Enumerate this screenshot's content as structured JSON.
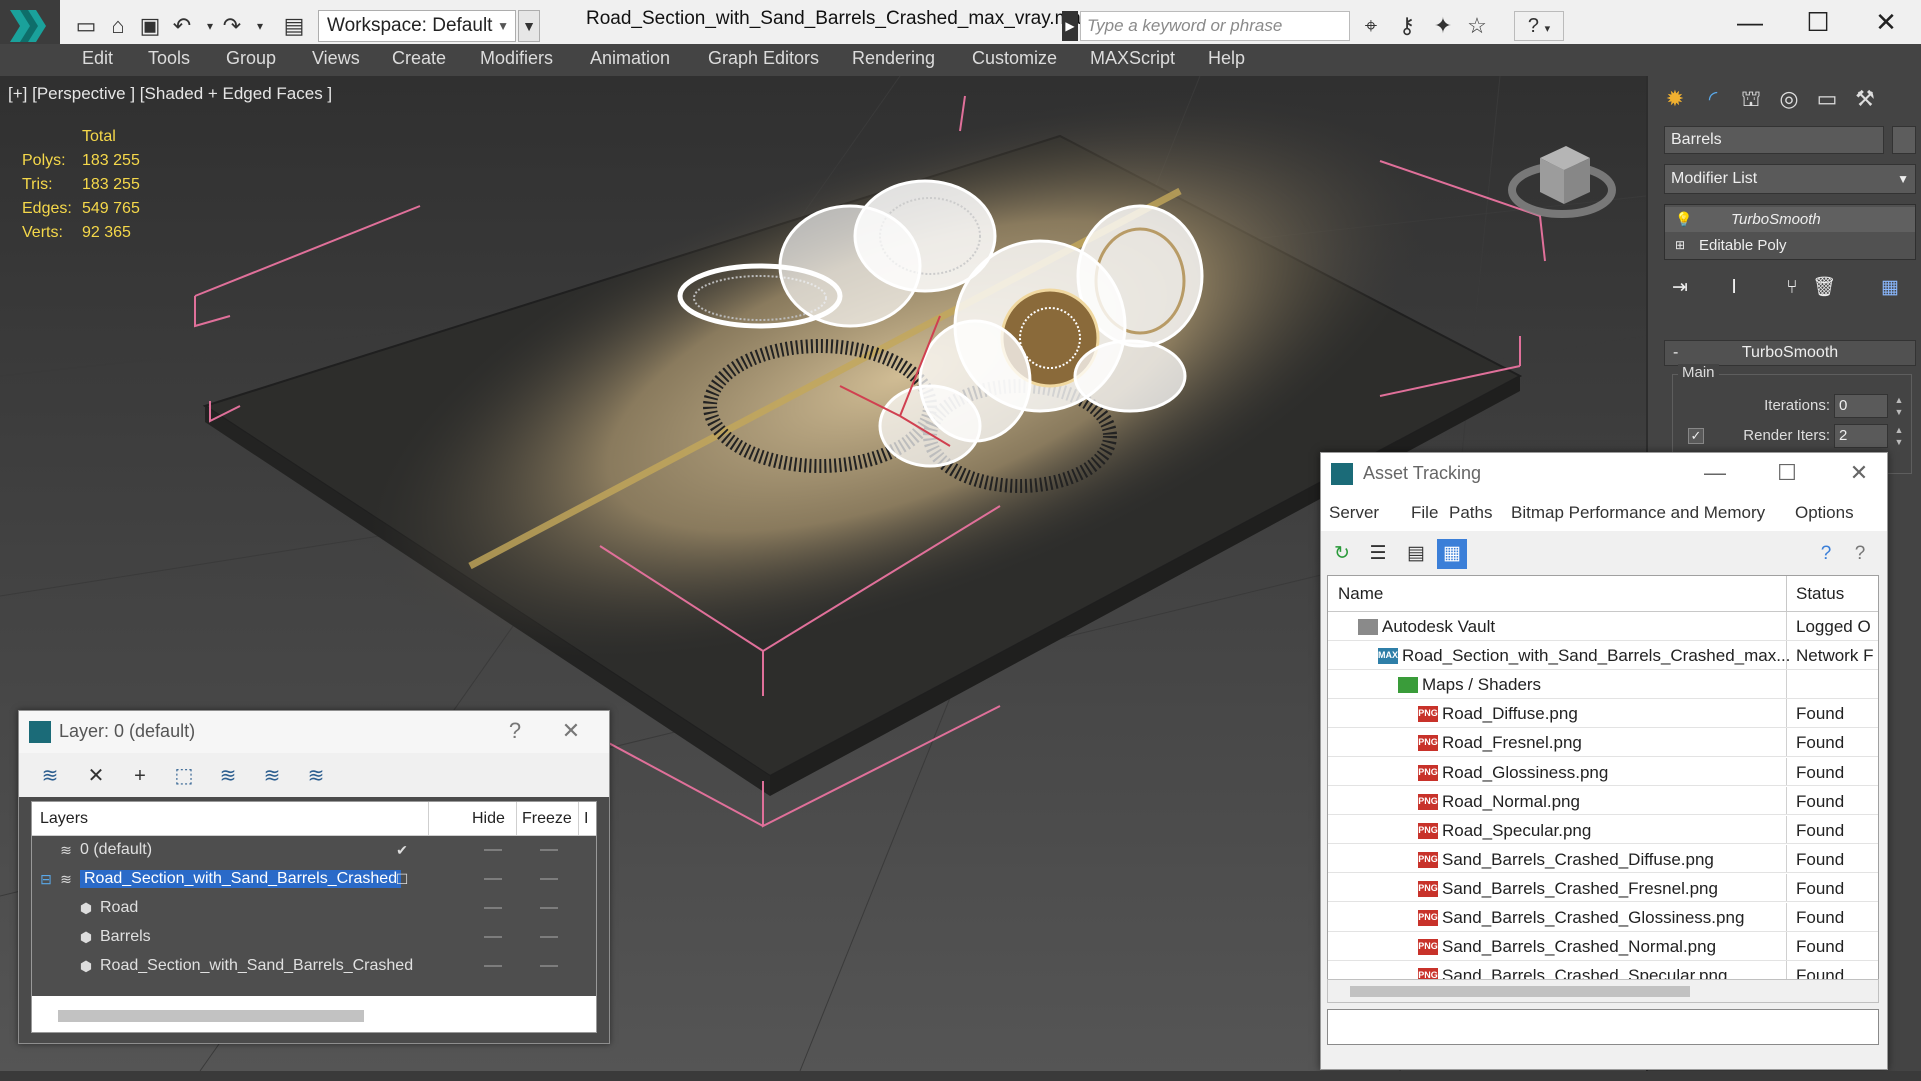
{
  "app": {
    "file_title": "Road_Section_with_Sand_Barrels_Crashed_max_vray.max",
    "workspace_label": "Workspace: Default",
    "search_placeholder": "Type a keyword or phrase"
  },
  "menus": [
    "Edit",
    "Tools",
    "Group",
    "Views",
    "Create",
    "Modifiers",
    "Animation",
    "Graph Editors",
    "Rendering",
    "Customize",
    "MAXScript",
    "Help"
  ],
  "viewport": {
    "label": "[+] [Perspective ] [Shaded + Edged Faces ]",
    "stats": {
      "header": "Total",
      "rows": [
        {
          "key": "Polys:",
          "value": "183 255"
        },
        {
          "key": "Tris:",
          "value": "183 255"
        },
        {
          "key": "Edges:",
          "value": "549 765"
        },
        {
          "key": "Verts:",
          "value": "92 365"
        }
      ]
    }
  },
  "command_panel": {
    "object_name": "Barrels",
    "modifier_list": "Modifier List",
    "stack": [
      "TurboSmooth",
      "Editable Poly"
    ],
    "rollout_title": "TurboSmooth",
    "group_label": "Main",
    "params": [
      {
        "label": "Iterations:",
        "value": "0"
      },
      {
        "label": "Render Iters:",
        "value": "2"
      }
    ]
  },
  "asset_tracking": {
    "title": "Asset Tracking",
    "menu": [
      "Server",
      "File",
      "Paths",
      "Bitmap Performance and Memory",
      "Options"
    ],
    "col_name": "Name",
    "col_status": "Status",
    "rows": [
      {
        "name": "Autodesk Vault",
        "status": "Logged O",
        "level": 0,
        "icon": "vault"
      },
      {
        "name": "Road_Section_with_Sand_Barrels_Crashed_max...",
        "status": "Network F",
        "level": 1,
        "icon": "max"
      },
      {
        "name": "Maps / Shaders",
        "status": "",
        "level": 2,
        "icon": "maps"
      },
      {
        "name": "Road_Diffuse.png",
        "status": "Found",
        "level": 3,
        "icon": "png"
      },
      {
        "name": "Road_Fresnel.png",
        "status": "Found",
        "level": 3,
        "icon": "png"
      },
      {
        "name": "Road_Glossiness.png",
        "status": "Found",
        "level": 3,
        "icon": "png"
      },
      {
        "name": "Road_Normal.png",
        "status": "Found",
        "level": 3,
        "icon": "png"
      },
      {
        "name": "Road_Specular.png",
        "status": "Found",
        "level": 3,
        "icon": "png"
      },
      {
        "name": "Sand_Barrels_Crashed_Diffuse.png",
        "status": "Found",
        "level": 3,
        "icon": "png"
      },
      {
        "name": "Sand_Barrels_Crashed_Fresnel.png",
        "status": "Found",
        "level": 3,
        "icon": "png"
      },
      {
        "name": "Sand_Barrels_Crashed_Glossiness.png",
        "status": "Found",
        "level": 3,
        "icon": "png"
      },
      {
        "name": "Sand_Barrels_Crashed_Normal.png",
        "status": "Found",
        "level": 3,
        "icon": "png"
      },
      {
        "name": "Sand_Barrels_Crashed_Specular.png",
        "status": "Found",
        "level": 3,
        "icon": "png"
      }
    ],
    "png_badge": "PNG",
    "max_badge": "MAX"
  },
  "layer_window": {
    "title": "Layer: 0 (default)",
    "help": "?",
    "col_layers": "Layers",
    "col_hide": "Hide",
    "col_freeze": "Freeze",
    "col_more": "I",
    "rows": [
      {
        "name": "0 (default)",
        "level": 0,
        "current": true,
        "selected": false
      },
      {
        "name": "Road_Section_with_Sand_Barrels_Crashed",
        "level": 0,
        "current": false,
        "selected": true
      },
      {
        "name": "Road",
        "level": 1,
        "current": false,
        "selected": false
      },
      {
        "name": "Barrels",
        "level": 1,
        "current": false,
        "selected": false
      },
      {
        "name": "Road_Section_with_Sand_Barrels_Crashed",
        "level": 1,
        "current": false,
        "selected": false
      }
    ]
  },
  "colors": {
    "viewport_bg": "#4a4a4a",
    "selection_blue": "#2a6ac8",
    "stats_yellow": "#f5d84a",
    "bbox_pink": "#e0709a"
  }
}
